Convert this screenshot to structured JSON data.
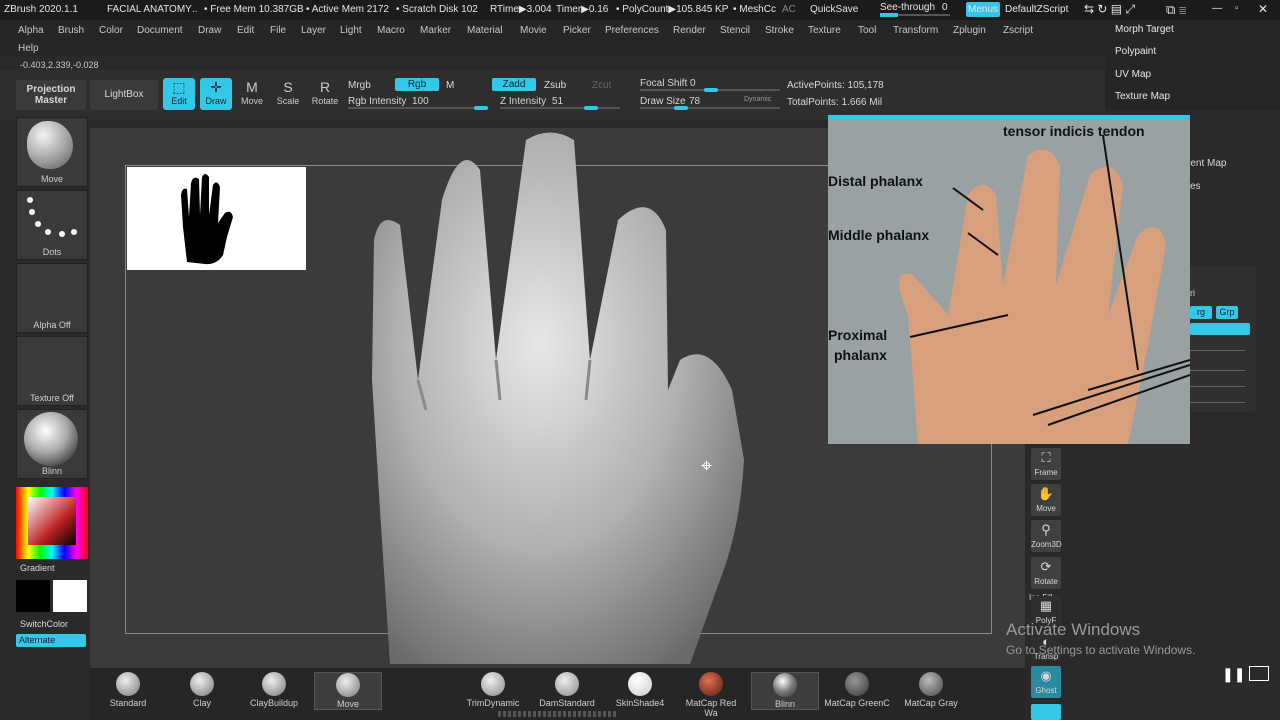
{
  "titlebar": {
    "app": "ZBrush 2020.1.1",
    "project": "FACIAL ANATOMY",
    "free_mem": "• Free Mem 10.387GB",
    "active_mem": "• Active Mem 2172",
    "scratch": "• Scratch Disk 102",
    "rtime": "RTime▶3.004",
    "timer": "Timer▶0.16",
    "polycount": "• PolyCount▶105.845 KP",
    "mesh": "• MeshCc",
    "ac": "AC",
    "quicksave": "QuickSave",
    "seethrough": "See-through",
    "seethrough_value": "0",
    "menus": "Menus",
    "script": "DefaultZScript"
  },
  "menu": [
    "Alpha",
    "Brush",
    "Color",
    "Document",
    "Draw",
    "Edit",
    "File",
    "Layer",
    "Light",
    "Macro",
    "Marker",
    "Material",
    "Movie",
    "Picker",
    "Preferences",
    "Render",
    "Stencil",
    "Stroke",
    "Texture",
    "Tool",
    "Transform",
    "Zplugin",
    "Zscript"
  ],
  "help": "Help",
  "coords": "-0.403,2.339,-0.028",
  "right_menu": [
    "Morph Target",
    "Polypaint",
    "UV Map",
    "Texture Map"
  ],
  "right_partial": [
    "ment Map",
    "es",
    "ri",
    "rg",
    "Grp"
  ],
  "toolbar": {
    "projection_master": "Projection Master",
    "lightbox": "LightBox",
    "edit": "Edit",
    "draw": "Draw",
    "move": "Move",
    "scale": "Scale",
    "rotate": "Rotate",
    "mrgb": "Mrgb",
    "rgb": "Rgb",
    "m": "M",
    "rgb_intensity_label": "Rgb Intensity",
    "rgb_intensity": "100",
    "zadd": "Zadd",
    "zsub": "Zsub",
    "zcut": "Zcut",
    "z_intensity_label": "Z Intensity",
    "z_intensity": "51",
    "focal_shift_label": "Focal Shift",
    "focal_shift": "0",
    "draw_size_label": "Draw Size",
    "draw_size": "78",
    "dynamic": "Dynamic",
    "active_points": "ActivePoints: 105,178",
    "total_points": "TotalPoints: 1.666 Mil"
  },
  "left_shelf": [
    "Move",
    "Dots",
    "Alpha Off",
    "Texture Off",
    "Blinn"
  ],
  "gradient": "Gradient",
  "switchcolor": "SwitchColor",
  "alternate": "Alternate",
  "photo_labels": {
    "tendon": "tensor indicis tendon",
    "distal": "Distal phalanx",
    "middle": "Middle phalanx",
    "proximal1": "Proximal",
    "proximal2": "phalanx"
  },
  "nav": [
    "Frame",
    "Move",
    "Zoom3D",
    "Rotate",
    "PolyF",
    "Transp",
    "Ghost"
  ],
  "nav_partial": "Ino Fill",
  "materials": [
    "Standard",
    "Clay",
    "ClayBuildup",
    "Move",
    "TrimDynamic",
    "DamStandard",
    "SkinShade4",
    "MatCap Red Wa",
    "Blinn",
    "MatCap GreenC",
    "MatCap Gray"
  ],
  "watermark": {
    "title": "Activate Windows",
    "sub": "Go to Settings to activate Windows."
  },
  "colors": {
    "accent": "#34c8e8",
    "bg": "#2a2a2a",
    "canvas": "#3b3b3b"
  }
}
